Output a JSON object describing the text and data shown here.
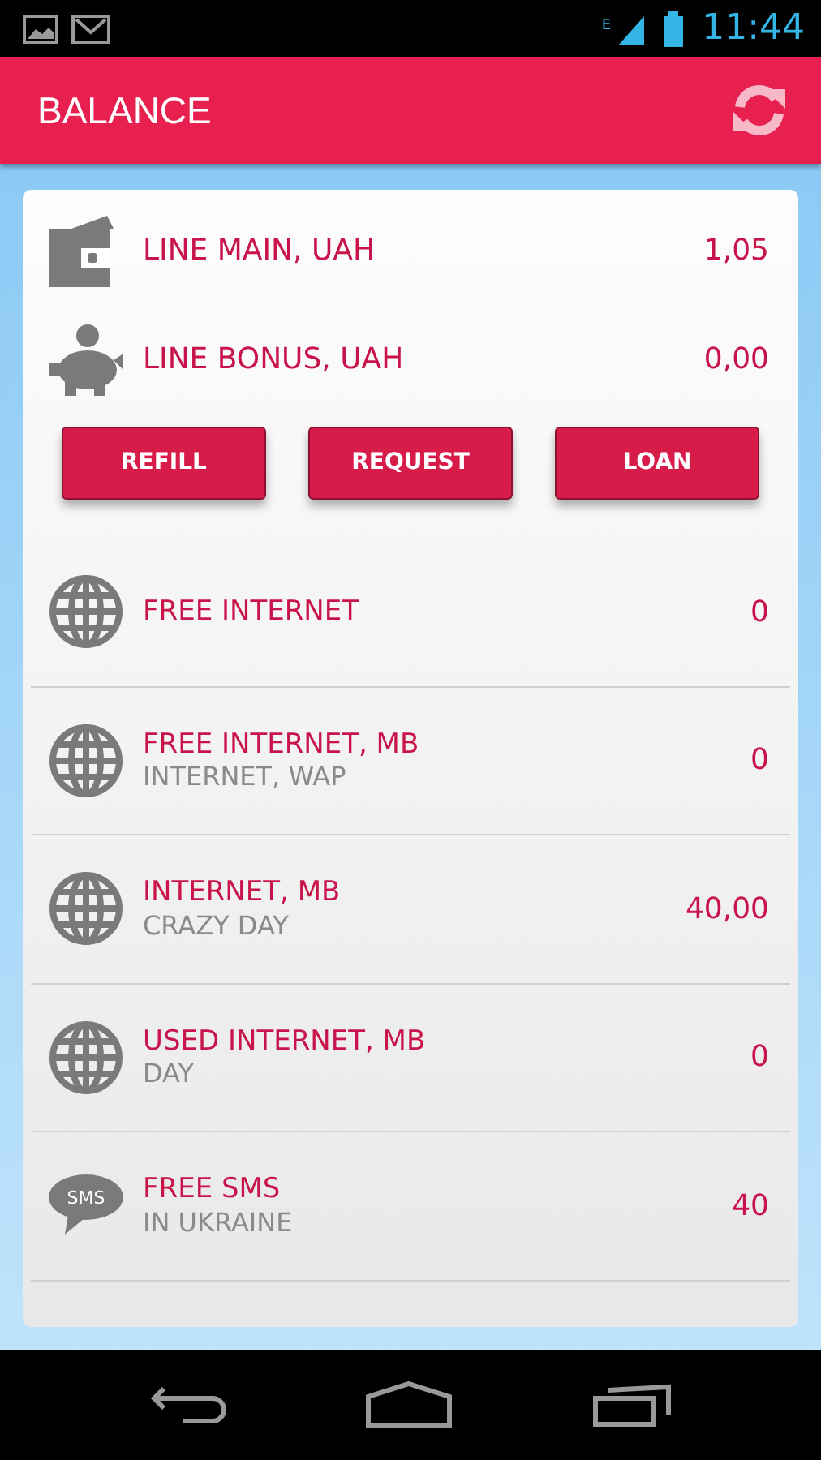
{
  "status_bar": {
    "network_type": "E",
    "time": "11:44"
  },
  "app_bar": {
    "title": "BALANCE"
  },
  "balances": [
    {
      "kind": "wallet",
      "label": "LINE MAIN, UAH",
      "value": "1,05"
    },
    {
      "kind": "piggy",
      "label": "LINE BONUS, UAH",
      "value": "0,00"
    }
  ],
  "buttons": [
    "REFILL",
    "REQUEST",
    "LOAN"
  ],
  "services": [
    {
      "kind": "globe",
      "title": "FREE INTERNET",
      "value": "0"
    },
    {
      "kind": "globe",
      "title": "FREE INTERNET, MB",
      "subtitle": "INTERNET, WAP",
      "value": "0"
    },
    {
      "kind": "globe",
      "title": "INTERNET, MB",
      "subtitle": "CRAZY DAY",
      "value": "40,00"
    },
    {
      "kind": "globe",
      "title": "USED INTERNET, MB",
      "subtitle": "DAY",
      "value": "0"
    },
    {
      "kind": "sms",
      "icon_text": "SMS",
      "title": "FREE SMS",
      "subtitle": "IN UKRAINE",
      "value": "40"
    }
  ]
}
